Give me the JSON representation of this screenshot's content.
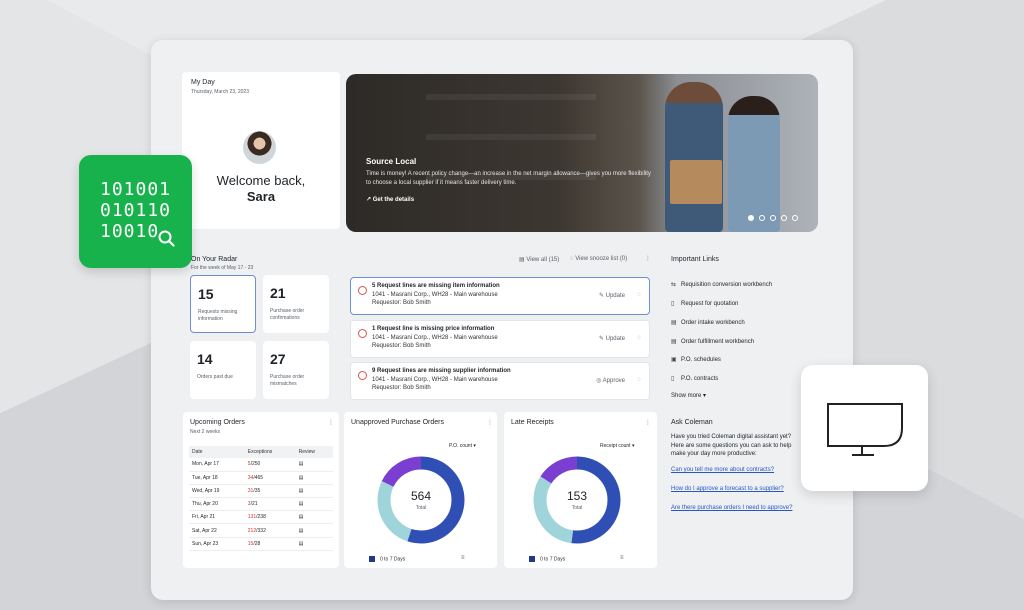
{
  "my_day": {
    "title": "My Day",
    "date": "Thursday, March 23, 2023",
    "welcome": "Welcome back,",
    "user": "Sara"
  },
  "hero": {
    "title": "Source Local",
    "text": "Time is money! A recent policy change—an increase in the net margin allowance—gives you more flexibility to choose a local supplier if it means faster delivery time.",
    "link": "Get the details",
    "slide_count": 5,
    "active_slide": 1
  },
  "radar": {
    "title": "On Your Radar",
    "subtitle": "For the week of May 17 - 23",
    "view_all": "View all (15)",
    "view_snooze": "View snooze list (0)",
    "stats": [
      {
        "value": "15",
        "label": "Requests missing information"
      },
      {
        "value": "21",
        "label": "Purchase order confirmations"
      },
      {
        "value": "14",
        "label": "Orders past due"
      },
      {
        "value": "27",
        "label": "Purchase order mismatches"
      }
    ],
    "requests": [
      {
        "title": "5 Request lines are missing item information",
        "line2": "1041 - Masrani Corp., WH28 - Main warehouse",
        "line3": "Requestor: Bob Smith",
        "action": "Update"
      },
      {
        "title": "1 Request line is missing price information",
        "line2": "1041 - Masrani Corp., WH28 - Main warehouse",
        "line3": "Requestor: Bob Smith",
        "action": "Update"
      },
      {
        "title": "9 Request lines are missing supplier information",
        "line2": "1041 - Masrani Corp., WH28 - Main warehouse",
        "line3": "Requestor: Bob Smith",
        "action": "Approve"
      }
    ]
  },
  "important_links": {
    "title": "Important Links",
    "items": [
      {
        "label": "Requisition conversion workbench",
        "icon": "convert-icon"
      },
      {
        "label": "Request for quotation",
        "icon": "document-icon"
      },
      {
        "label": "Order intake workbench",
        "icon": "list-icon"
      },
      {
        "label": "Order fulfillment workbench",
        "icon": "list-icon"
      },
      {
        "label": "P.O. schedules",
        "icon": "calendar-icon"
      },
      {
        "label": "P.O. contracts",
        "icon": "document-icon"
      }
    ],
    "show_more": "Show more"
  },
  "upcoming": {
    "title": "Upcoming Orders",
    "subtitle": "Next 2 weeks",
    "columns": [
      "Date",
      "Exceptions",
      "Review"
    ],
    "rows": [
      {
        "date": "Mon, Apr 17",
        "exc": "5",
        "total": "/250"
      },
      {
        "date": "Tue, Apr 18",
        "exc": "34",
        "total": "/465"
      },
      {
        "date": "Wed, Apr 19",
        "exc": "31",
        "total": "/35"
      },
      {
        "date": "Thu, Apr 20",
        "exc": "3",
        "total": "/21"
      },
      {
        "date": "Fri, Apr 21",
        "exc": "131",
        "total": "/238"
      },
      {
        "date": "Sat, Apr 22",
        "exc": "212",
        "total": "/332"
      },
      {
        "date": "Sun, Apr 23",
        "exc": "15",
        "total": "/28"
      }
    ]
  },
  "unapproved": {
    "title": "Unapproved Purchase Orders",
    "filter": "P.O. count",
    "total": "564",
    "total_label": "Total",
    "legend": "0 to 7 Days",
    "segments": [
      {
        "value": 0.55,
        "color": "#2f4fb5"
      },
      {
        "value": 0.27,
        "color": "#9fd5da"
      },
      {
        "value": 0.18,
        "color": "#7a3fd1"
      }
    ]
  },
  "late_receipts": {
    "title": "Late Receipts",
    "filter": "Receipt count",
    "total": "153",
    "total_label": "Total",
    "legend": "0 to 7 Days",
    "segments": [
      {
        "value": 0.52,
        "color": "#2f4fb5"
      },
      {
        "value": 0.32,
        "color": "#9fd5da"
      },
      {
        "value": 0.16,
        "color": "#7a3fd1"
      }
    ]
  },
  "coleman": {
    "title": "Ask Coleman",
    "intro": "Have you tried Coleman digital assistant yet? Here are some questions you can ask to help make your day more productive:",
    "questions": [
      "Can you tell me more about contracts?",
      "How do I approve a forecast to a supplier?",
      "Are there purchase orders I need to approve?"
    ]
  },
  "badge": {
    "binary": [
      "101001",
      "010110",
      "10010"
    ]
  },
  "colors": {
    "accent": "#2857c5",
    "green": "#18b24c",
    "exception": "#d9342b"
  }
}
